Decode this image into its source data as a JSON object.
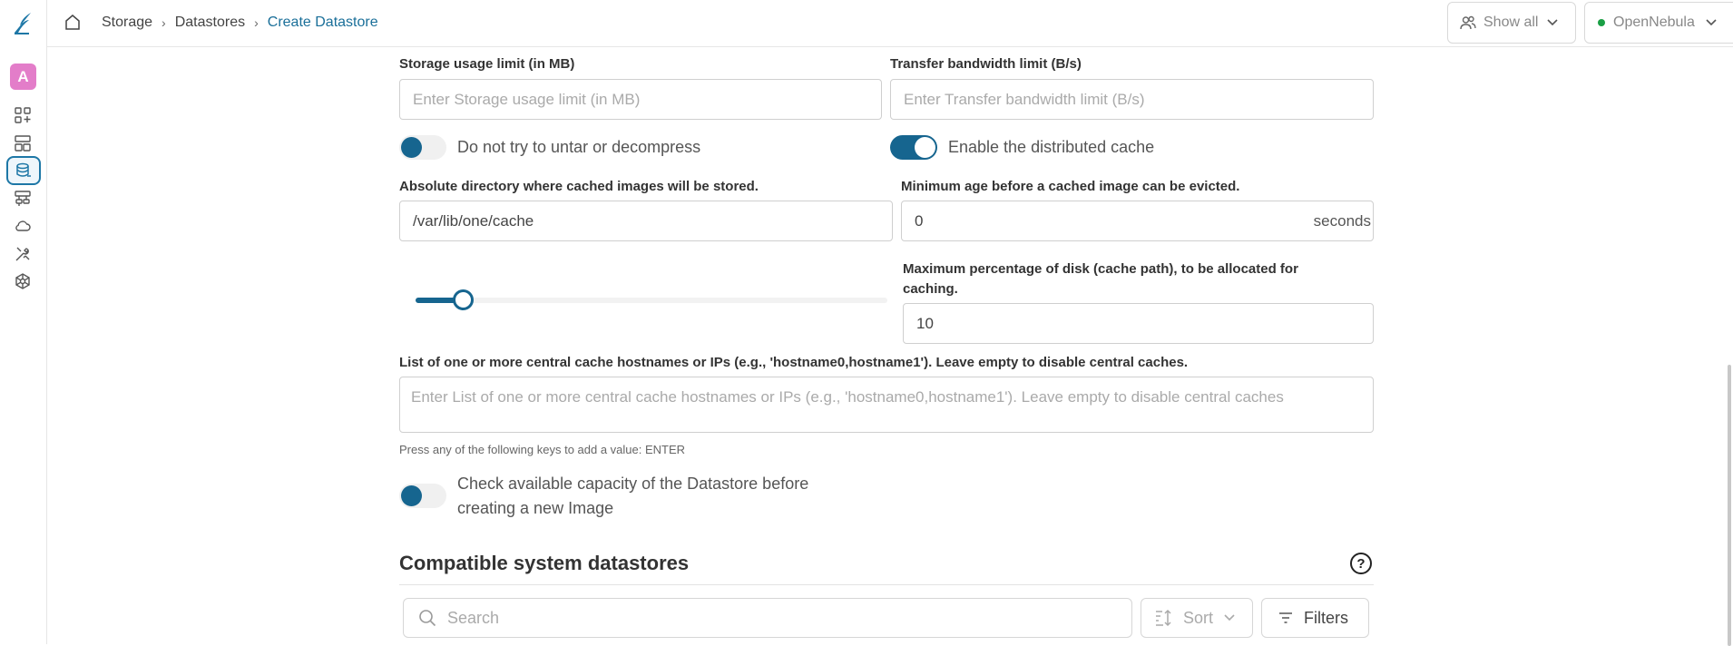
{
  "breadcrumb": [
    "Storage",
    "Datastores",
    "Create Datastore"
  ],
  "header": {
    "show_all": "Show all",
    "zone": "OpenNebula",
    "zone_status_color": "#1a9f45"
  },
  "sidebar": {
    "avatar": "A",
    "items": [
      "apps-icon",
      "dashboard-icon",
      "storage-icon",
      "network-icon",
      "cloud-icon",
      "tools-icon",
      "settings-icon"
    ],
    "active_item": "storage-icon",
    "accent_color": "#1d77a6"
  },
  "form": {
    "storage_limit": {
      "label": "Storage usage limit (in MB)",
      "placeholder": "Enter Storage usage limit (in MB)"
    },
    "bandwidth_limit": {
      "label": "Transfer bandwidth limit (B/s)",
      "placeholder": "Enter Transfer bandwidth limit (B/s)"
    },
    "no_decompress": {
      "label": "Do not try to untar or decompress",
      "checked": false
    },
    "distributed_cache": {
      "label": "Enable the distributed cache",
      "checked": true
    },
    "cache_dir": {
      "label": "Absolute directory where cached images will be stored.",
      "value": "/var/lib/one/cache"
    },
    "min_age": {
      "label": "Minimum age before a cached image can be evicted.",
      "value": "0",
      "unit": "seconds"
    },
    "max_percentage": {
      "label": "Maximum percentage of disk (cache path), to be allocated for caching.",
      "value": "10",
      "slider_percent": 10
    },
    "central_caches": {
      "label": "List of one or more central cache hostnames or IPs (e.g., 'hostname0,hostname1'). Leave empty to disable central caches.",
      "placeholder": "Enter List of one or more central cache hostnames or IPs (e.g., 'hostname0,hostname1'). Leave empty to disable central caches",
      "helper": "Press any of the following keys to add a value: ENTER"
    },
    "check_capacity": {
      "label_line1": "Check available capacity of the Datastore before",
      "label_line2": "creating a new Image",
      "checked": false
    }
  },
  "compatible": {
    "title": "Compatible system datastores",
    "search_placeholder": "Search",
    "sort_label": "Sort",
    "filters_label": "Filters"
  }
}
